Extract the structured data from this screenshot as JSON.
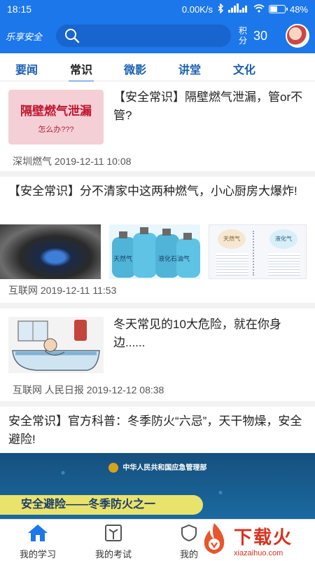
{
  "status_bar": {
    "time": "18:15",
    "network_speed": "0.00K/s",
    "battery_percent": "48%",
    "battery_level": 0.48
  },
  "header": {
    "logo_text": "乐享安全",
    "search_placeholder": "",
    "points_label_1": "积",
    "points_label_2": "分",
    "points_value": "30"
  },
  "tabs": [
    {
      "label": "要闻"
    },
    {
      "label": "常识"
    },
    {
      "label": "微影"
    },
    {
      "label": "讲堂"
    },
    {
      "label": "文化"
    }
  ],
  "feed": [
    {
      "title": "【安全常识】隔壁燃气泄漏，管or不管?",
      "source": "深圳燃气",
      "date": "2019-12-11 10:08",
      "thumb_text": "隔壁燃气泄漏",
      "thumb_subtext": "怎么办???"
    },
    {
      "title": "【安全常识】分不清家中这两种燃气，小心厨房大爆炸!",
      "source": "互联网",
      "date": "2019-12-11 11:53",
      "thumb2_text_a": "液化石油气",
      "thumb2_text_b": "天然气",
      "thumb3_text_a": "天然气",
      "thumb3_text_b": "液化气"
    },
    {
      "title": "冬天常见的10大危险，就在你身边......",
      "source": "互联网 人民日报",
      "date": "2019-12-12 08:38"
    },
    {
      "title": "安全常识】官方科普：冬季防火“六忌”，天干物燥，安全避险!",
      "banner_org": "中华人民共和国应急管理部",
      "banner_text": "安全避险——冬季防火之一"
    }
  ],
  "bottom_nav": [
    {
      "label": "我的学习"
    },
    {
      "label": "我的考试"
    },
    {
      "label": "我的"
    }
  ],
  "watermark": {
    "cn": "下载火",
    "en": "xiazaihuo.com"
  },
  "colors": {
    "brand_blue": "#1c78ea",
    "tab_blue": "#1a5fb4",
    "watermark_red": "#d8321e"
  }
}
